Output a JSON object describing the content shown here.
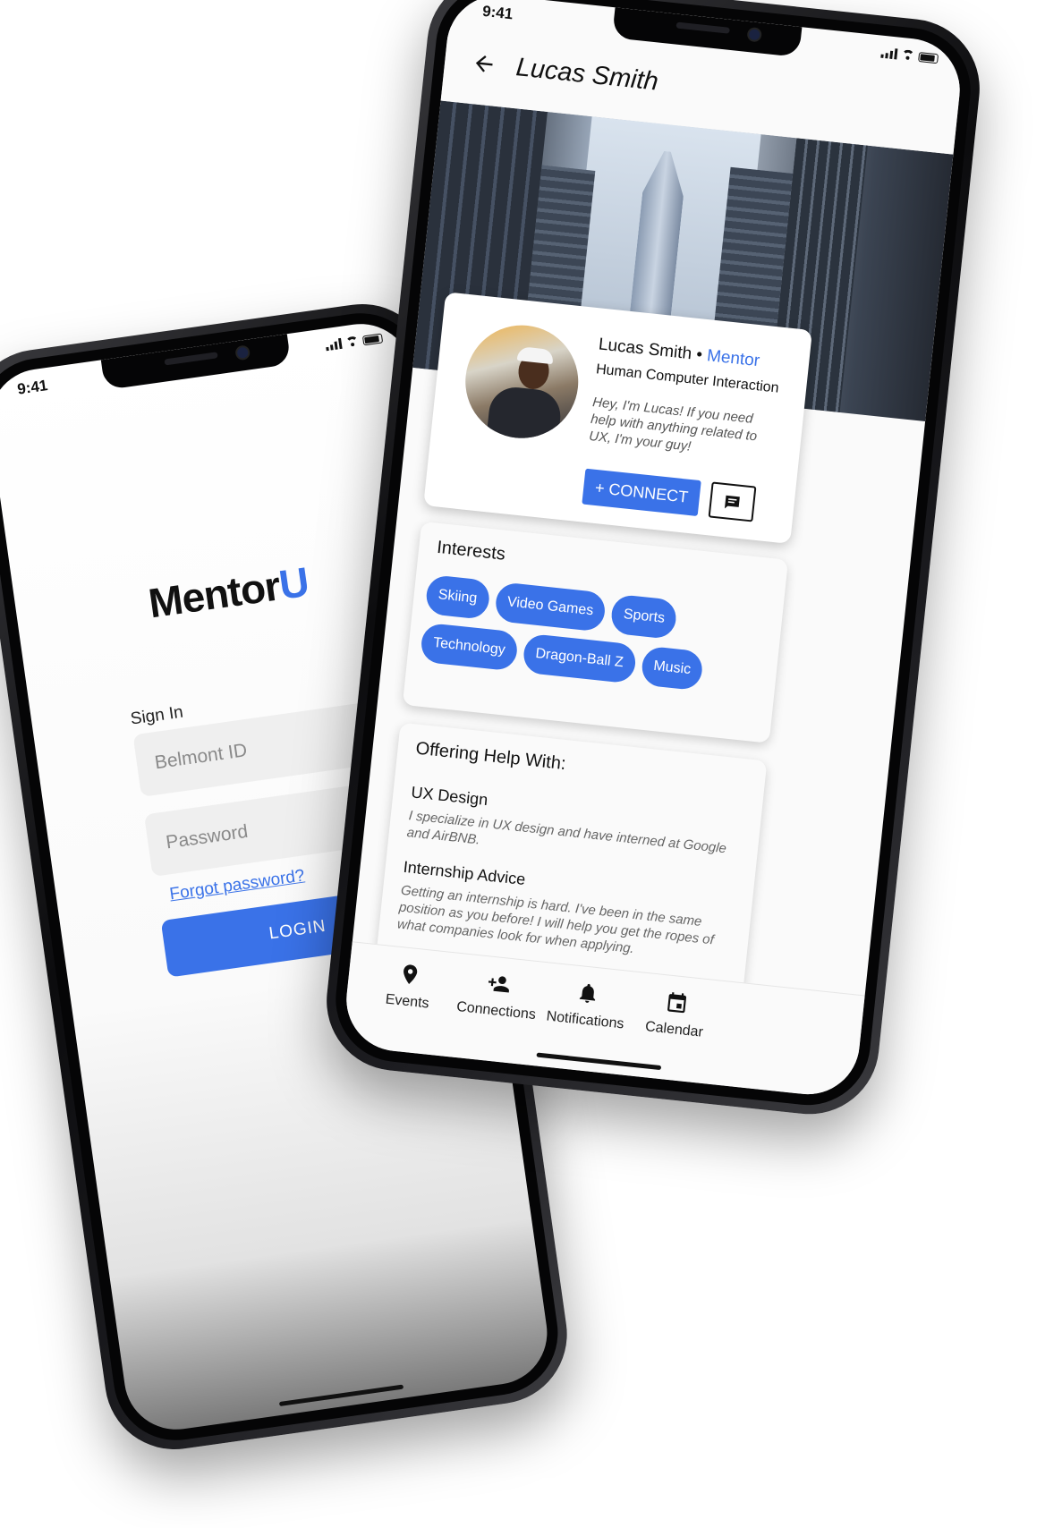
{
  "status": {
    "time": "9:41"
  },
  "login": {
    "logo_main": "Mentor",
    "logo_accent": "U",
    "signin_label": "Sign In",
    "id_placeholder": "Belmont ID",
    "password_placeholder": "Password",
    "forgot_label": "Forgot password?",
    "login_label": "LOGIN"
  },
  "profile": {
    "appbar_title": "Lucas Smith",
    "name": "Lucas Smith",
    "separator": " • ",
    "role": "Mentor",
    "field": "Human Computer Interaction",
    "bio": "Hey, I'm Lucas! If you need help with anything related to UX, I'm your guy!",
    "connect_label": "+ CONNECT",
    "interests_title": "Interests",
    "interests": [
      "Skiing",
      "Video Games",
      "Sports",
      "Technology",
      "Dragon-Ball Z",
      "Music"
    ],
    "offering_title": "Offering Help With:",
    "offerings": [
      {
        "title": "UX Design",
        "text": "I specialize in UX design and have interned at Google and AirBNB."
      },
      {
        "title": "Internship Advice",
        "text": "Getting an internship is hard. I've been in the same position as you before! I will help you get the ropes of what companies look for when applying."
      }
    ],
    "nav": [
      {
        "label": "Events",
        "icon": "location-pin-icon"
      },
      {
        "label": "Connections",
        "icon": "add-person-icon"
      },
      {
        "label": "Notifications",
        "icon": "bell-icon"
      },
      {
        "label": "Calendar",
        "icon": "calendar-icon"
      }
    ]
  },
  "colors": {
    "accent": "#3a72e8",
    "frame": "#0c0c0e"
  }
}
